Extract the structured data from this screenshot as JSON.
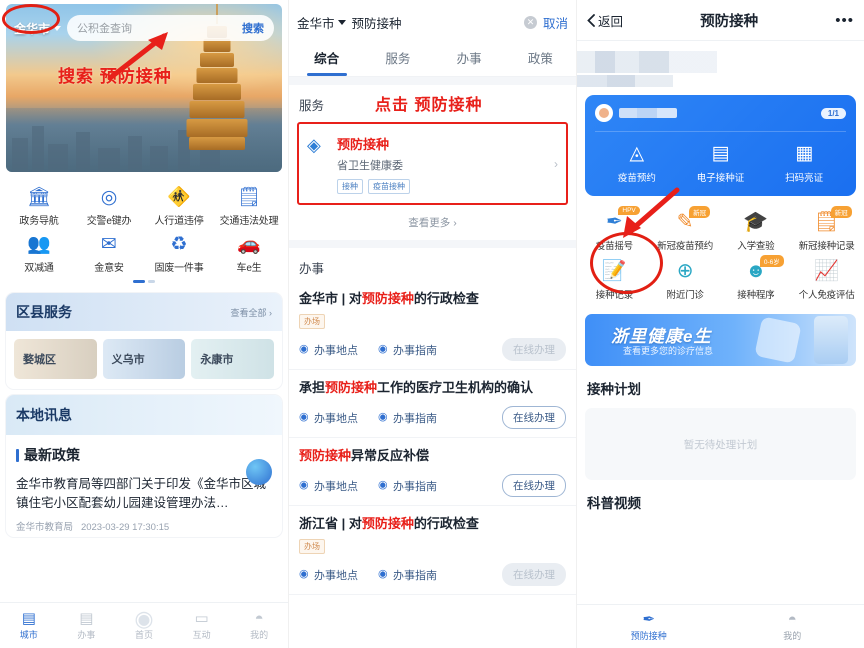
{
  "left": {
    "search": {
      "city": "金华市",
      "placeholder": "公积金查询",
      "button": "搜索"
    },
    "annotation": "搜索 预防接种",
    "quick_icons": [
      {
        "label": "政务导航",
        "icon": "bank-icon",
        "color": "blue"
      },
      {
        "label": "交警e键办",
        "icon": "police-icon",
        "color": "blue"
      },
      {
        "label": "人行道违停",
        "icon": "parking-icon",
        "color": "orange"
      },
      {
        "label": "交通违法处理",
        "icon": "document-icon",
        "color": "blue"
      },
      {
        "label": "双减通",
        "icon": "people-icon",
        "color": "teal"
      },
      {
        "label": "金意安",
        "icon": "mail-icon",
        "color": "blue"
      },
      {
        "label": "固废一件事",
        "icon": "recycle-icon",
        "color": "blue"
      },
      {
        "label": "车e生",
        "icon": "car-icon",
        "color": "blue"
      }
    ],
    "region_section": {
      "title": "区县服务",
      "more": "查看全部 ›",
      "regions": [
        "婺城区",
        "义乌市",
        "永康市"
      ]
    },
    "news_section": {
      "title": "本地讯息"
    },
    "policy": {
      "title": "最新政策",
      "body": "金华市教育局等四部门关于印发《金华市区城镇住宅小区配套幼儿园建设管理办法…",
      "source": "金华市教育局",
      "time": "2023-03-29 17:30:15"
    },
    "tabbar": [
      {
        "label": "城市",
        "icon": "city-icon",
        "active": true
      },
      {
        "label": "办事",
        "icon": "clipboard-icon",
        "active": false
      },
      {
        "label": "首页",
        "icon": "home-logo-icon",
        "active": false
      },
      {
        "label": "互动",
        "icon": "chat-icon",
        "active": false
      },
      {
        "label": "我的",
        "icon": "person-icon",
        "active": false
      }
    ]
  },
  "middle": {
    "search": {
      "city": "金华市",
      "value": "预防接种",
      "clear": "✕",
      "cancel": "取消"
    },
    "tabs": [
      {
        "label": "综合",
        "active": true
      },
      {
        "label": "服务",
        "active": false
      },
      {
        "label": "办事",
        "active": false
      },
      {
        "label": "政策",
        "active": false
      }
    ],
    "service_section": {
      "title": "服务",
      "annotation": "点击 预防接种",
      "card": {
        "name": "预防接种",
        "org": "省卫生健康委",
        "tags": [
          "接种",
          "疫苗接种"
        ],
        "chevron": "›"
      },
      "more": "查看更多 ›"
    },
    "banshi_section": {
      "title": "办事",
      "items": [
        {
          "prefix": "金华市 | 对",
          "highlight": "预防接种",
          "suffix": "的行政检查",
          "tag": "办场",
          "links": [
            "办事地点",
            "办事指南"
          ],
          "action": "在线办理",
          "action_disabled": true
        },
        {
          "prefix": "承担",
          "highlight": "预防接种",
          "suffix": "工作的医疗卫生机构的确认",
          "tag": "",
          "links": [
            "办事地点",
            "办事指南"
          ],
          "action": "在线办理",
          "action_disabled": false
        },
        {
          "prefix": "",
          "highlight": "预防接种",
          "suffix": "异常反应补偿",
          "tag": "",
          "links": [
            "办事地点",
            "办事指南"
          ],
          "action": "在线办理",
          "action_disabled": false
        },
        {
          "prefix": "浙江省 | 对",
          "highlight": "预防接种",
          "suffix": "的行政检查",
          "tag": "办场",
          "links": [
            "办事地点",
            "办事指南"
          ],
          "action": "在线办理",
          "action_disabled": true
        }
      ]
    }
  },
  "right": {
    "nav": {
      "back": "返回",
      "title": "预防接种",
      "menu": "•••"
    },
    "blue_card": {
      "count": "1/1",
      "items": [
        {
          "label": "疫苗预约",
          "icon": "syringe-icon"
        },
        {
          "label": "电子接种证",
          "icon": "certificate-icon"
        },
        {
          "label": "扫码亮证",
          "icon": "qrcode-icon"
        }
      ]
    },
    "grid": [
      {
        "label": "疫苗摇号",
        "icon": "syringe-lottery-icon",
        "badge": "HPV",
        "color": "blue"
      },
      {
        "label": "新冠疫苗预约",
        "icon": "vaccine-booking-icon",
        "badge": "新冠",
        "color": "orange"
      },
      {
        "label": "入学查验",
        "icon": "graduation-icon",
        "badge": "",
        "color": "orange"
      },
      {
        "label": "新冠接种记录",
        "icon": "record-icon",
        "badge": "新冠",
        "color": "orange"
      },
      {
        "label": "接种记录",
        "icon": "edit-record-icon",
        "badge": "",
        "color": "orange"
      },
      {
        "label": "附近门诊",
        "icon": "clinic-icon",
        "badge": "",
        "color": "teal"
      },
      {
        "label": "接种程序",
        "icon": "baby-icon",
        "badge": "0-6岁",
        "color": "teal"
      },
      {
        "label": "个人免疫评估",
        "icon": "chart-icon",
        "badge": "",
        "color": "orange"
      }
    ],
    "banner": {
      "title": "浙里健康e生",
      "subtitle": "查看更多您的诊疗信息"
    },
    "plan_section": {
      "title": "接种计划",
      "empty": "暂无待处理计划"
    },
    "video_section": {
      "title": "科普视频"
    },
    "tabbar": [
      {
        "label": "预防接种",
        "icon": "syringe-icon",
        "active": true
      },
      {
        "label": "我的",
        "icon": "person-icon",
        "active": false
      }
    ]
  },
  "accents": {
    "red": "#e8201a",
    "blue": "#2f6fd0",
    "orange": "#f08a2a"
  }
}
